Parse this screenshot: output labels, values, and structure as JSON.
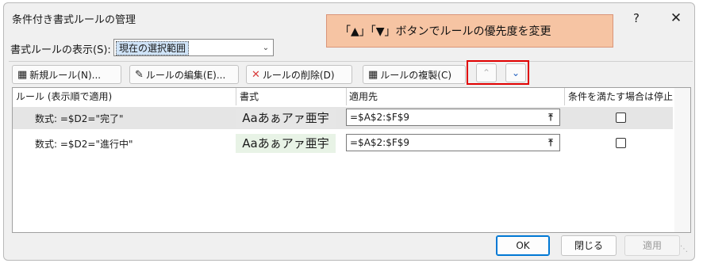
{
  "window": {
    "title": "条件付き書式ルールの管理",
    "help": "?",
    "close": "✕"
  },
  "callout": {
    "text": "「▲」「▼」ボタンでルールの優先度を変更"
  },
  "show": {
    "label": "書式ルールの表示(S):",
    "selected": "現在の選択範囲"
  },
  "toolbar": {
    "new": "新規ルール(N)...",
    "edit": "ルールの編集(E)...",
    "delete": "ルールの削除(D)",
    "duplicate": "ルールの複製(C)"
  },
  "table": {
    "headers": [
      "ルール (表示順で適用)",
      "書式",
      "適用先",
      "条件を満たす場合は停止"
    ],
    "rows": [
      {
        "rule": "数式: =$D2=\"完了\"",
        "preview": "Aaあぁアァ亜宇",
        "applies": "=$A$2:$F$9",
        "stop": false
      },
      {
        "rule": "数式: =$D2=\"進行中\"",
        "preview": "Aaあぁアァ亜宇",
        "applies": "=$A$2:$F$9",
        "stop": false
      }
    ]
  },
  "buttons": {
    "ok": "OK",
    "close": "閉じる",
    "apply": "適用"
  },
  "colors": {
    "accent": "#0078d4",
    "callout": "#f6c4a3",
    "highlight": "#e00000"
  }
}
